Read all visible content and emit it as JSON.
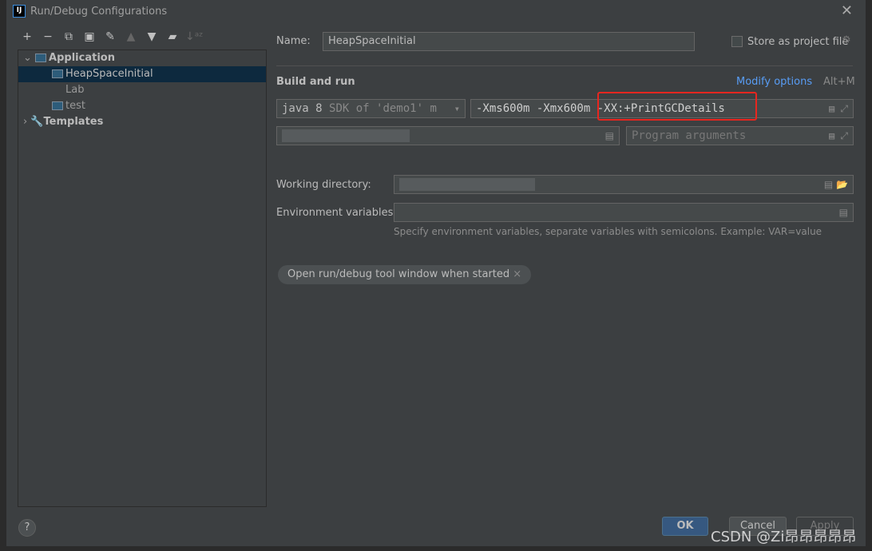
{
  "window": {
    "title": "Run/Debug Configurations",
    "logo": "IJ"
  },
  "toolbar": [
    "+",
    "−",
    "⧉",
    "💾",
    "🔧",
    "▲",
    "▼",
    "📁",
    "↓ᵃᶻ"
  ],
  "tree": {
    "application": "Application",
    "items": [
      "HeapSpaceInitial",
      "Lab",
      "test"
    ],
    "templates": "Templates"
  },
  "form": {
    "name_label": "Name:",
    "name_value": "HeapSpaceInitial",
    "store_label": "Store as project file",
    "section": "Build and run",
    "modify": "Modify options",
    "modify_shortcut": "Alt+M",
    "jdk": "java 8",
    "jdk_hint": "SDK of 'demo1' m",
    "vm_options": "-Xms600m -Xmx600m -XX:+PrintGCDetails",
    "program_args_placeholder": "Program arguments",
    "workdir_label": "Working directory:",
    "env_label": "Environment variables:",
    "env_hint": "Specify environment variables, separate variables with semicolons. Example: VAR=value",
    "chip": "Open run/debug tool window when started"
  },
  "buttons": {
    "ok": "OK",
    "cancel": "Cancel",
    "apply": "Apply",
    "help": "?"
  },
  "watermark": "CSDN @Zi昂昂昂昂昂",
  "colors": {
    "highlight": "#e8261f",
    "link": "#589df6",
    "primary": "#365880"
  }
}
